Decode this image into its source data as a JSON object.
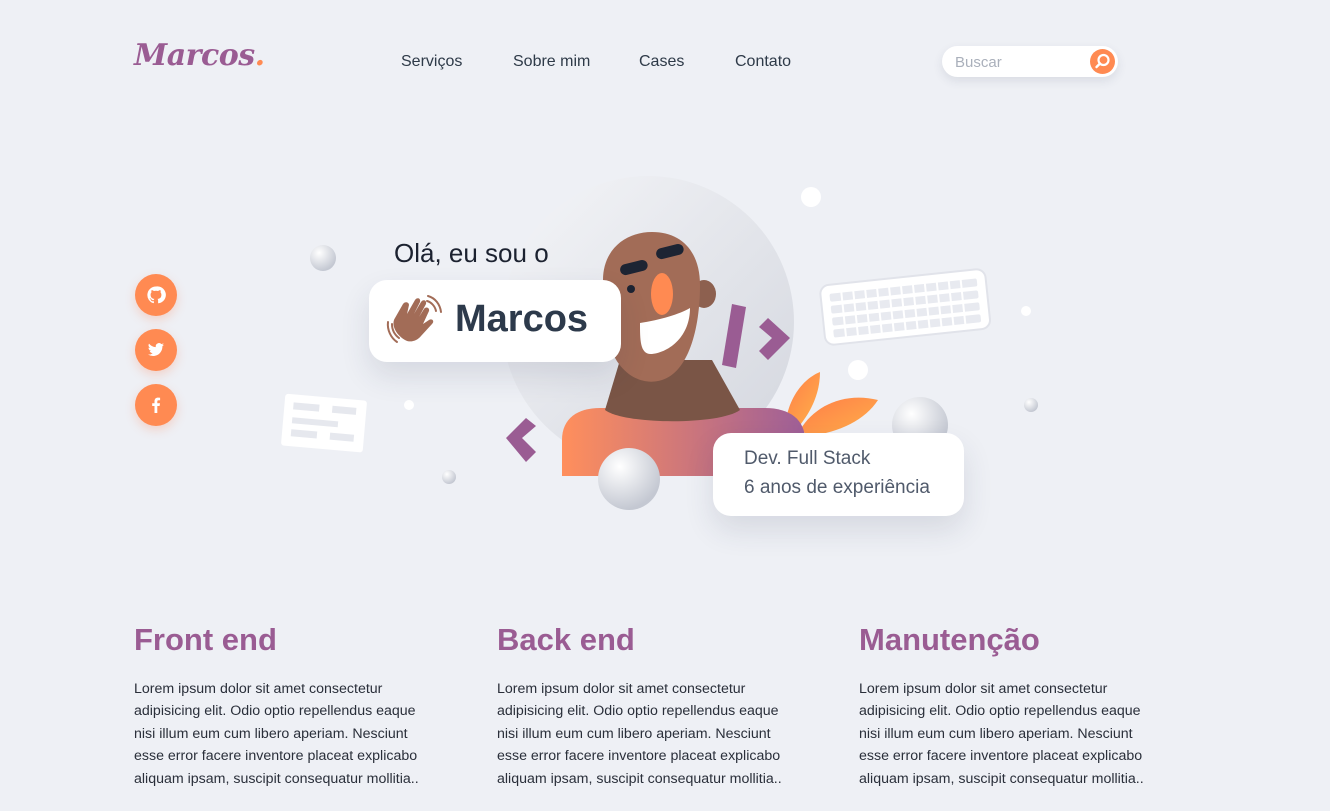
{
  "logo": {
    "text": "Marcos",
    "dot": "."
  },
  "nav": {
    "items": [
      "Serviços",
      "Sobre mim",
      "Cases",
      "Contato"
    ]
  },
  "search": {
    "placeholder": "Buscar",
    "value": "",
    "button_icon": "search-icon"
  },
  "social": [
    {
      "icon": "github-icon"
    },
    {
      "icon": "twitter-icon"
    },
    {
      "icon": "facebook-icon"
    }
  ],
  "hero": {
    "greeting": "Olá, eu sou o",
    "name": "Marcos",
    "role": "Dev. Full Stack",
    "experience": "6 anos de experiência",
    "illustration": "waving-hand-icon, developer-avatar, keyboard, code-brackets"
  },
  "services": [
    {
      "title": "Front end",
      "body": "Lorem ipsum dolor sit amet consectetur adipisicing elit. Odio optio repellendus eaque nisi illum eum cum libero aperiam. Nesciunt esse error facere inventore placeat explicabo aliquam ipsam, suscipit consequatur mollitia.."
    },
    {
      "title": "Back end",
      "body": "Lorem ipsum dolor sit amet consectetur adipisicing elit. Odio optio repellendus eaque nisi illum eum cum libero aperiam. Nesciunt esse error facere inventore placeat explicabo aliquam ipsam, suscipit consequatur mollitia.."
    },
    {
      "title": "Manutenção",
      "body": "Lorem ipsum dolor sit amet consectetur adipisicing elit. Odio optio repellendus eaque nisi illum eum cum libero aperiam. Nesciunt esse error facere inventore placeat explicabo aliquam ipsam, suscipit consequatur mollitia.."
    }
  ],
  "colors": {
    "accent": "#ff8a52",
    "brand": "#9a5c93",
    "background": "#eef0f5",
    "text": "#2e3a48"
  }
}
